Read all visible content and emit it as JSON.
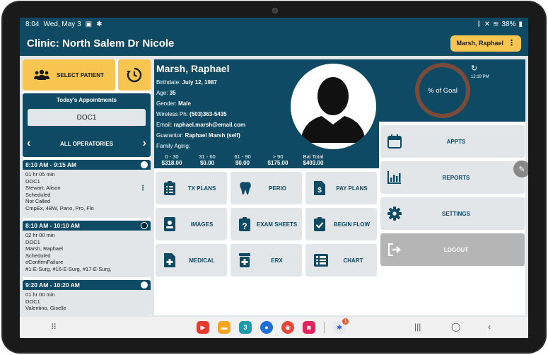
{
  "status_bar": {
    "time": "8:04",
    "date": "Wed, May 3",
    "battery": "38%"
  },
  "header": {
    "clinic_title": "Clinic: North Salem Dr Nicole",
    "user_name": "Marsh, Raphael"
  },
  "left": {
    "select_patient_label": "SELECT PATIENT",
    "today_title": "Today's Appointments",
    "doctor": "DOC1",
    "operatories_label": "ALL OPERATORIES",
    "appointments": [
      {
        "time": "8:10 AM  -  9:15 AM",
        "duration": "01 hr 05 min",
        "provider": "DOC1",
        "patient": "Stewart, Alison",
        "status": "Scheduled",
        "confirm": "Not Called",
        "procedures": "CmpEx, 4BW, Pano, Pro, Flo"
      },
      {
        "time": "8:10 AM  -  10:10 AM",
        "duration": "02 hr 00 min",
        "provider": "DOC1",
        "patient": "Marsh, Raphael",
        "status": "Scheduled",
        "confirm": "eConfirmFailure",
        "procedures": "#1-E-Surg, #16-E-Surg, #17-E-Surg,"
      },
      {
        "time": "9:20 AM  -  10:20 AM",
        "duration": "01 hr 00 min",
        "provider": "DOC1",
        "patient": "Valentino, Giselle"
      }
    ]
  },
  "patient": {
    "name": "Marsh, Raphael",
    "birthdate_label": "Birthdate:",
    "birthdate": "July 12, 1987",
    "age_label": "Age:",
    "age": "35",
    "gender_label": "Gender:",
    "gender": "Male",
    "phone_label": "Wireless Ph:",
    "phone": "(503)363-5435",
    "email_label": "Email:",
    "email": "raphael.marsh@email.com",
    "guarantor_label": "Guarantor:",
    "guarantor": "Raphael Marsh (self)",
    "aging_label": "Family Aging:",
    "aging": [
      {
        "label": "0 - 30",
        "value": "$318.00"
      },
      {
        "label": "31 - 60",
        "value": "$0.00"
      },
      {
        "label": "61 - 90",
        "value": "$0.00"
      },
      {
        "label": "> 90",
        "value": "$175.00"
      },
      {
        "label": "Bal Total",
        "value": "$493.00"
      }
    ]
  },
  "tiles": {
    "tx_plans": "TX PLANS",
    "perio": "PERIO",
    "pay_plans": "PAY PLANS",
    "images": "IMAGES",
    "exam_sheets": "EXAM SHEETS",
    "begin_flow": "BEGIN FLOW",
    "medical": "MEDICAL",
    "erx": "ERX",
    "chart": "CHART"
  },
  "right": {
    "goal_label": "% of Goal",
    "goal_time": "12:19 PM",
    "appts": "APPTS",
    "reports": "REPORTS",
    "settings": "SETTINGS",
    "logout": "LOGOUT"
  },
  "dock": {
    "calendar_day": "3",
    "settings_badge": "1"
  },
  "colors": {
    "primary": "#0e4a63",
    "accent": "#f7c550",
    "tile": "#e3e6e8",
    "goal_ring": "#7a4a3a"
  },
  "icons": {
    "select_patient": "users-icon",
    "history": "history-icon",
    "tx_plans": "clipboard-list-icon",
    "perio": "tooth-icon",
    "pay_plans": "dollar-file-icon",
    "images": "id-badge-icon",
    "exam_sheets": "clipboard-question-icon",
    "begin_flow": "clipboard-check-icon",
    "medical": "medical-file-icon",
    "erx": "pill-bottle-icon",
    "chart": "list-icon",
    "appts": "calendar-icon",
    "reports": "bar-chart-icon",
    "settings": "gear-icon",
    "logout": "logout-icon"
  }
}
